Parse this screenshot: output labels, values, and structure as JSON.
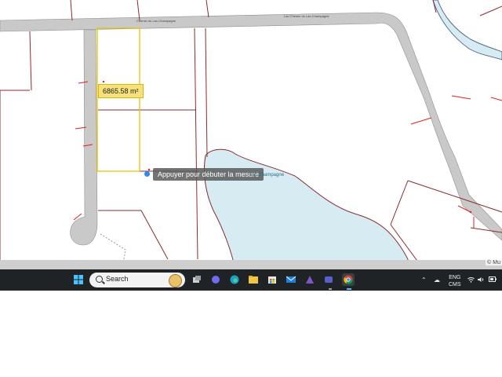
{
  "map": {
    "measure_value": "6865.58 m²",
    "measure_tooltip": "Appuyer pour débuter la mesure",
    "lake_name": "Lac Champagne",
    "road_label_left": "Chemin du Lac-Champagne",
    "road_label_right": "Lac Chemin du Lac-Champagne",
    "copyright": "© Mu",
    "colors": {
      "road": "#c9c9c9",
      "parcel": "#8b2b2b",
      "lake": "#d6ebf2",
      "measure_outline": "#e8c200",
      "accent": "#e02020"
    }
  },
  "taskbar": {
    "search_placeholder": "Search",
    "language": "ENG",
    "layout": "CMS",
    "icons": [
      "windows-start-icon",
      "search-icon",
      "task-view-icon",
      "meet-icon",
      "edge-icon",
      "file-explorer-icon",
      "store-icon",
      "mail-icon",
      "copilot-icon",
      "teams-icon",
      "chrome-icon"
    ],
    "tray_icons": [
      "chevron-up-icon",
      "weather-icon",
      "wifi-icon",
      "volume-icon",
      "battery-icon"
    ]
  }
}
